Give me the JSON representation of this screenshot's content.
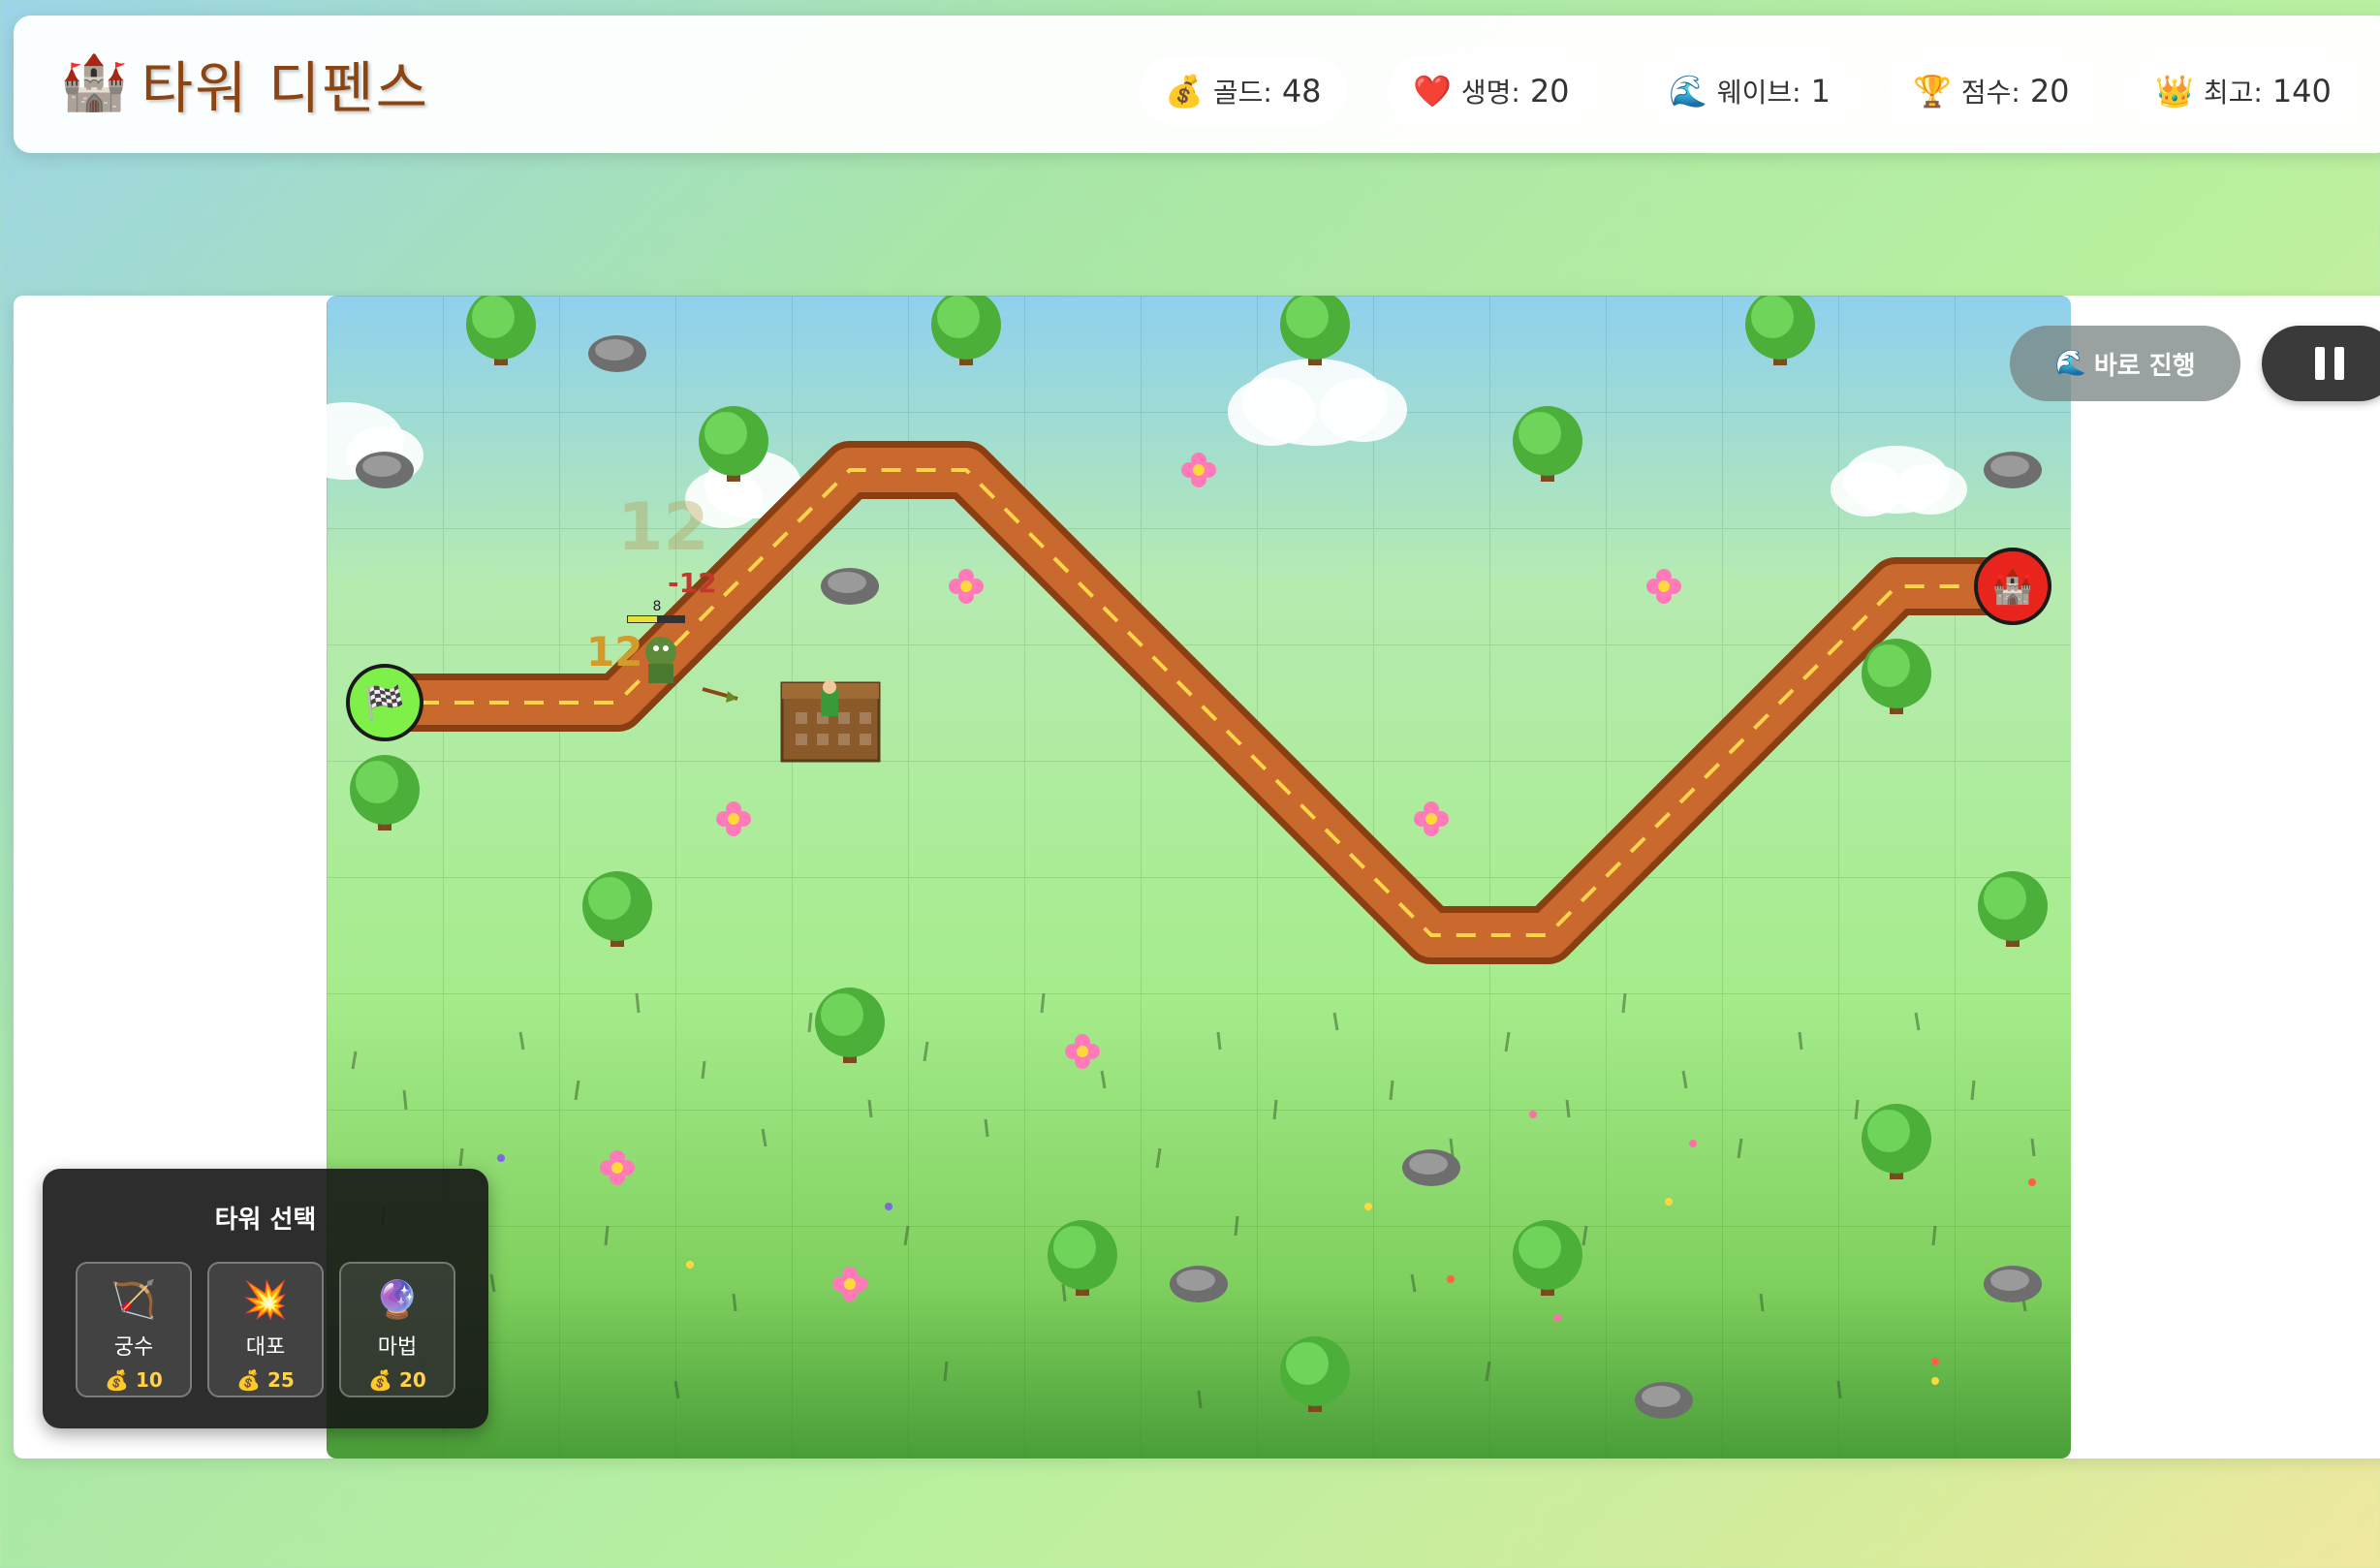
{
  "header": {
    "title_icon": "🏰",
    "title": "타워 디펜스",
    "stats": [
      {
        "icon": "💰",
        "label": "골드:",
        "value": "48"
      },
      {
        "icon": "❤️",
        "label": "생명:",
        "value": "20"
      },
      {
        "icon": "🌊",
        "label": "웨이브:",
        "value": "1"
      },
      {
        "icon": "🏆",
        "label": "점수:",
        "value": "20"
      },
      {
        "icon": "👑",
        "label": "최고:",
        "value": "140"
      }
    ]
  },
  "controls": {
    "fast_icon": "🌊",
    "fast_label": "바로 진행",
    "pause_icon": "pause-icon"
  },
  "board": {
    "start_icon": "🏁",
    "end_icon": "🏰",
    "floating_damage": [
      "12",
      "-12",
      "12"
    ],
    "enemy_hp_label": "8"
  },
  "tower_panel": {
    "title": "타워 선택",
    "towers": [
      {
        "icon": "🏹",
        "name": "궁수",
        "cost_icon": "💰",
        "cost": "10"
      },
      {
        "icon": "💥",
        "name": "대포",
        "cost_icon": "💰",
        "cost": "25"
      },
      {
        "icon": "🔮",
        "name": "마법",
        "cost_icon": "💰",
        "cost": "20"
      }
    ]
  }
}
